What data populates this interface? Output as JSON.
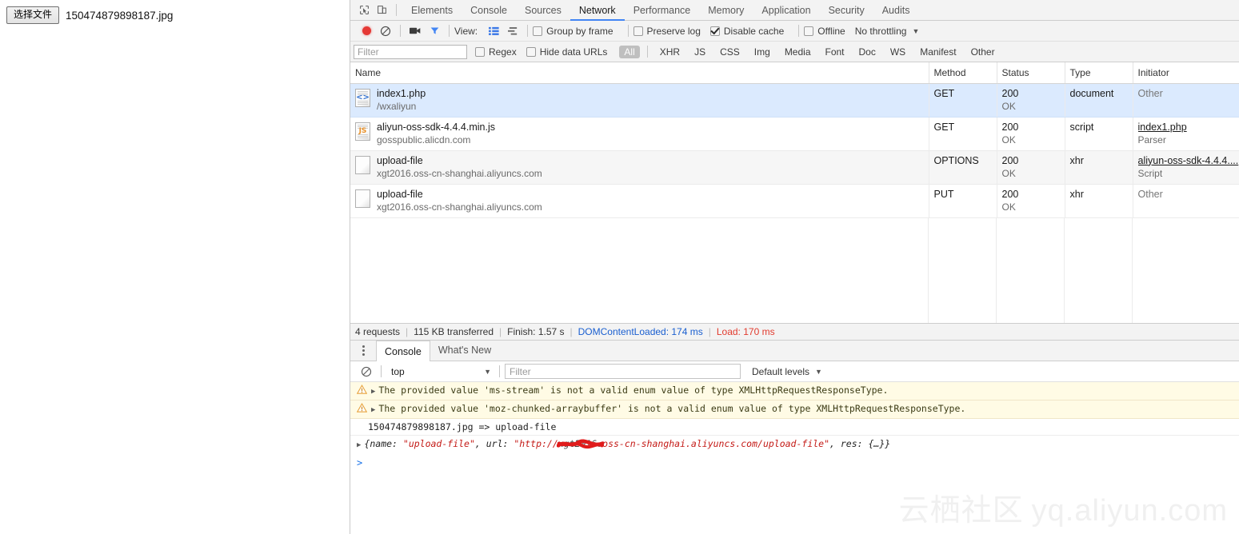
{
  "page": {
    "file_input": {
      "button_label": "选择文件",
      "file_name": "150474879898187.jpg"
    }
  },
  "devtools": {
    "tabs": [
      {
        "label": "Elements",
        "active": false
      },
      {
        "label": "Console",
        "active": false
      },
      {
        "label": "Sources",
        "active": false
      },
      {
        "label": "Network",
        "active": true
      },
      {
        "label": "Performance",
        "active": false
      },
      {
        "label": "Memory",
        "active": false
      },
      {
        "label": "Application",
        "active": false
      },
      {
        "label": "Security",
        "active": false
      },
      {
        "label": "Audits",
        "active": false
      }
    ],
    "tab_icons": {
      "inspect": "inspect-element-icon",
      "device": "device-toolbar-icon"
    },
    "network_toolbar": {
      "record_icon": "record-button",
      "clear_icon": "clear-icon",
      "camera_icon": "capture-screenshots-icon",
      "filter_icon": "filter-icon",
      "view_label": "View:",
      "view_list_icon": "list-view-icon",
      "view_waterfall_icon": "waterfall-view-icon",
      "group_by_frame": {
        "label": "Group by frame",
        "checked": false
      },
      "preserve_log": {
        "label": "Preserve log",
        "checked": false
      },
      "disable_cache": {
        "label": "Disable cache",
        "checked": true
      },
      "offline": {
        "label": "Offline",
        "checked": false
      },
      "throttling": "No throttling"
    },
    "filter_bar": {
      "placeholder": "Filter",
      "value": "",
      "regex": {
        "label": "Regex",
        "checked": false
      },
      "hide_data_urls": {
        "label": "Hide data URLs",
        "checked": false
      },
      "types": [
        {
          "label": "All",
          "active": true
        },
        {
          "label": "XHR",
          "active": false
        },
        {
          "label": "JS",
          "active": false
        },
        {
          "label": "CSS",
          "active": false
        },
        {
          "label": "Img",
          "active": false
        },
        {
          "label": "Media",
          "active": false
        },
        {
          "label": "Font",
          "active": false
        },
        {
          "label": "Doc",
          "active": false
        },
        {
          "label": "WS",
          "active": false
        },
        {
          "label": "Manifest",
          "active": false
        },
        {
          "label": "Other",
          "active": false
        }
      ]
    },
    "requests_table": {
      "columns": [
        "Name",
        "Method",
        "Status",
        "Type",
        "Initiator"
      ],
      "rows": [
        {
          "name": "index1.php",
          "domain": "/wxaliyun",
          "icon": "document-file-icon",
          "icon_glyph": "<>",
          "method": "GET",
          "status_code": "200",
          "status_text": "OK",
          "type": "document",
          "initiator": "Other",
          "initiator_sub": "",
          "initiator_is_link": false,
          "selected": true
        },
        {
          "name": "aliyun-oss-sdk-4.4.4.min.js",
          "domain": "gosspublic.alicdn.com",
          "icon": "javascript-file-icon",
          "icon_glyph": "JS",
          "method": "GET",
          "status_code": "200",
          "status_text": "OK",
          "type": "script",
          "initiator": "index1.php",
          "initiator_sub": "Parser",
          "initiator_is_link": true,
          "selected": false
        },
        {
          "name": "upload-file",
          "domain": "xgt2016.oss-cn-shanghai.aliyuncs.com",
          "icon": "generic-file-icon",
          "icon_glyph": "",
          "method": "OPTIONS",
          "status_code": "200",
          "status_text": "OK",
          "type": "xhr",
          "initiator": "aliyun-oss-sdk-4.4.4....",
          "initiator_sub": "Script",
          "initiator_is_link": true,
          "selected": false
        },
        {
          "name": "upload-file",
          "domain": "xgt2016.oss-cn-shanghai.aliyuncs.com",
          "icon": "generic-file-icon",
          "icon_glyph": "",
          "method": "PUT",
          "status_code": "200",
          "status_text": "OK",
          "type": "xhr",
          "initiator": "Other",
          "initiator_sub": "",
          "initiator_is_link": false,
          "selected": false
        }
      ]
    },
    "summary": {
      "requests": "4 requests",
      "transferred": "115 KB transferred",
      "finish": "Finish: 1.57 s",
      "dom_content_loaded": "DOMContentLoaded: 174 ms",
      "load": "Load: 170 ms",
      "dom_color": "#1a5fd0",
      "load_color": "#e23b2e"
    },
    "drawer": {
      "menu_icon": "more-options-icon",
      "tabs": [
        {
          "label": "Console",
          "active": true
        },
        {
          "label": "What's New",
          "active": false
        }
      ],
      "toolbar": {
        "clear_icon": "clear-console-icon",
        "context": "top",
        "filter_placeholder": "Filter",
        "filter_value": "",
        "levels": "Default levels"
      },
      "messages": [
        {
          "kind": "warning",
          "icon": "warning-triangle-icon",
          "expander": "expand-arrow-icon",
          "text": "The provided value 'ms-stream' is not a valid enum value of type XMLHttpRequestResponseType."
        },
        {
          "kind": "warning",
          "icon": "warning-triangle-icon",
          "expander": "expand-arrow-icon",
          "text": "The provided value 'moz-chunked-arraybuffer' is not a valid enum value of type XMLHttpRequestResponseType."
        },
        {
          "kind": "log",
          "text": "150474879898187.jpg => upload-file"
        }
      ],
      "object_line": {
        "expander": "expand-arrow-icon",
        "open_brace": "{name: ",
        "name_value": "\"upload-file\"",
        "url_key": ", url: ",
        "url_prefix": "\"http://",
        "url_redacted": "xgt2016.",
        "url_suffix": "oss-cn-shanghai.aliyuncs.com/upload-file\"",
        "tail": ", res: {…}}"
      },
      "prompt": ">"
    }
  },
  "watermark": {
    "cjk": "云栖社区",
    "domain": "yq.aliyun.com",
    "color": "#f0f0f0"
  }
}
